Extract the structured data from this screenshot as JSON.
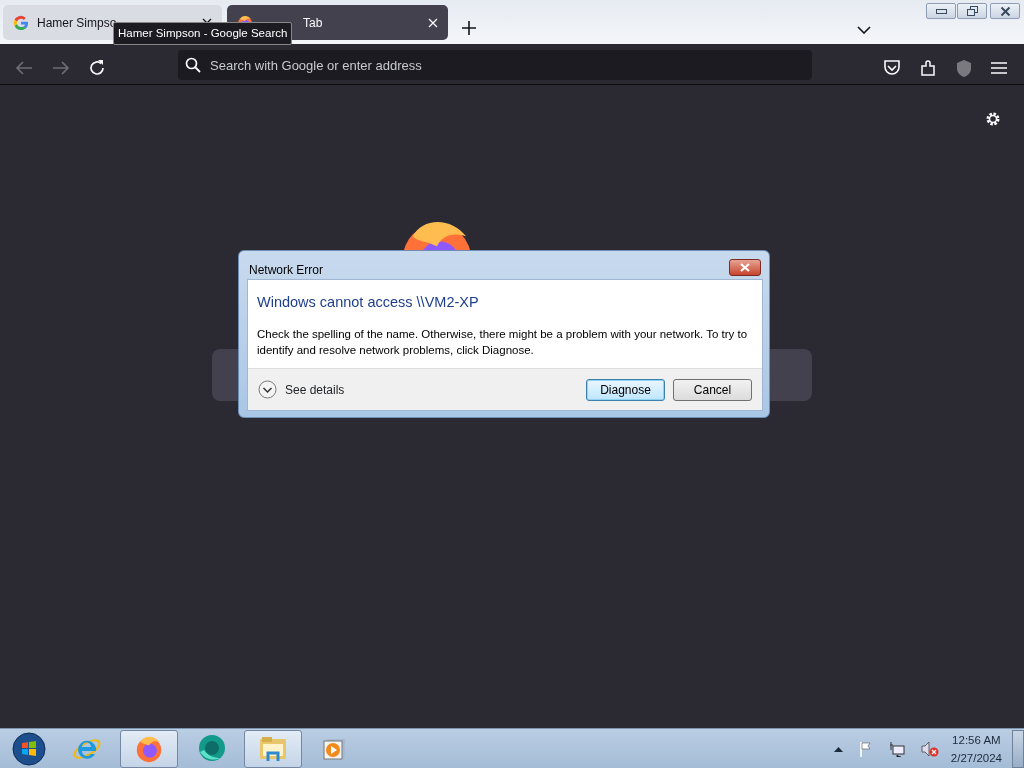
{
  "tabs": [
    {
      "label": "Hamer Simpso",
      "selected": false,
      "kind": "google"
    },
    {
      "label": "Tab",
      "selected": true,
      "kind": "firefox"
    }
  ],
  "tooltip": "Hamer Simpson - Google Search",
  "address_bar": {
    "placeholder": "Search with Google or enter address"
  },
  "dialog": {
    "title": "Network Error",
    "heading": "Windows cannot access \\\\VM2-XP",
    "message": "Check the spelling of the name. Otherwise, there might be a problem with your network. To try to identify and resolve network problems, click Diagnose.",
    "details_label": "See details",
    "buttons": [
      {
        "label": "Diagnose",
        "default": true
      },
      {
        "label": "Cancel",
        "default": false
      }
    ]
  },
  "taskbar": {
    "apps": [
      {
        "kind": "ie",
        "active": false
      },
      {
        "kind": "firefox",
        "active": true
      },
      {
        "kind": "chat",
        "active": false
      },
      {
        "kind": "explorer",
        "active": true
      },
      {
        "kind": "media",
        "active": false
      }
    ],
    "volume_muted": true,
    "time": "12:56 AM",
    "date": "2/27/2024"
  }
}
